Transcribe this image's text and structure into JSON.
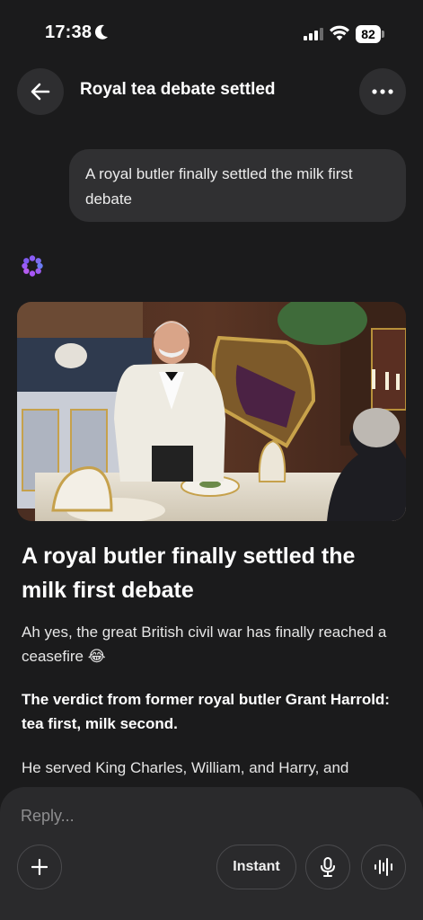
{
  "status": {
    "time": "17:38",
    "battery": "82"
  },
  "header": {
    "title": "Royal tea debate settled"
  },
  "user_message": "A royal butler finally settled the milk first debate",
  "article": {
    "title": "A royal butler finally settled the milk first debate",
    "p1": "Ah yes, the great British civil war has finally reached a ceasefire 😂",
    "p2": "The verdict from former royal butler Grant Harrold: tea first, milk second.",
    "p3": "He served King Charles, William, and Harry, and"
  },
  "composer": {
    "placeholder": "Reply...",
    "instant_label": "Instant"
  },
  "colors": {
    "background": "#1b1b1c",
    "bubble": "#303032",
    "composer": "#2a2a2c",
    "accent": "#8b5cf6"
  }
}
